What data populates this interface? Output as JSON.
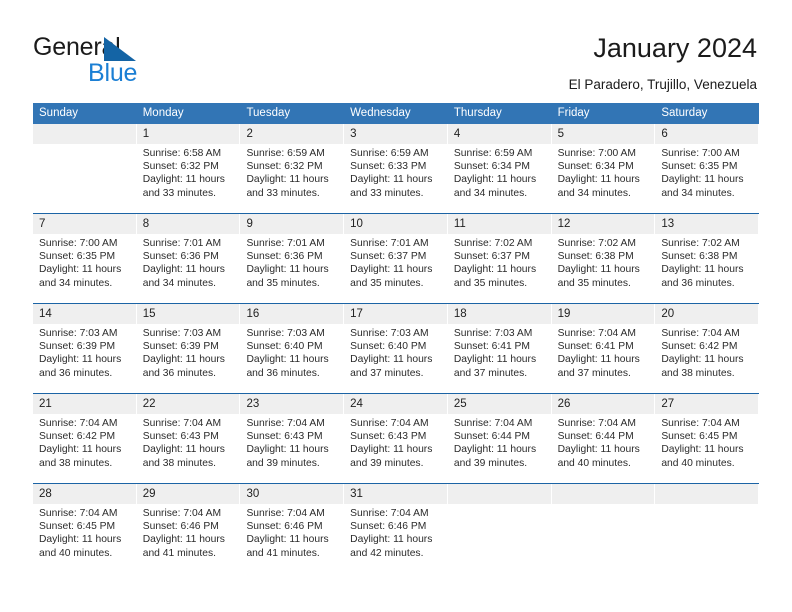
{
  "logo": {
    "word_top": "General",
    "word_bottom": "Blue",
    "triangle_color": "#1464a5",
    "blue_color": "#1b7fd4"
  },
  "header": {
    "title": "January 2024",
    "subtitle": "El Paradero, Trujillo, Venezuela"
  },
  "theme": {
    "header_blue": "#3275b5",
    "separator_blue": "#1c64a5",
    "num_band_gray": "#efefef"
  },
  "calendar": {
    "day_names": [
      "Sunday",
      "Monday",
      "Tuesday",
      "Wednesday",
      "Thursday",
      "Friday",
      "Saturday"
    ],
    "weeks": [
      [
        {
          "day": "",
          "sunrise": "",
          "sunset": "",
          "daylight_line1": "",
          "daylight_line2": ""
        },
        {
          "day": "1",
          "sunrise": "Sunrise: 6:58 AM",
          "sunset": "Sunset: 6:32 PM",
          "daylight_line1": "Daylight: 11 hours",
          "daylight_line2": "and 33 minutes."
        },
        {
          "day": "2",
          "sunrise": "Sunrise: 6:59 AM",
          "sunset": "Sunset: 6:32 PM",
          "daylight_line1": "Daylight: 11 hours",
          "daylight_line2": "and 33 minutes."
        },
        {
          "day": "3",
          "sunrise": "Sunrise: 6:59 AM",
          "sunset": "Sunset: 6:33 PM",
          "daylight_line1": "Daylight: 11 hours",
          "daylight_line2": "and 33 minutes."
        },
        {
          "day": "4",
          "sunrise": "Sunrise: 6:59 AM",
          "sunset": "Sunset: 6:34 PM",
          "daylight_line1": "Daylight: 11 hours",
          "daylight_line2": "and 34 minutes."
        },
        {
          "day": "5",
          "sunrise": "Sunrise: 7:00 AM",
          "sunset": "Sunset: 6:34 PM",
          "daylight_line1": "Daylight: 11 hours",
          "daylight_line2": "and 34 minutes."
        },
        {
          "day": "6",
          "sunrise": "Sunrise: 7:00 AM",
          "sunset": "Sunset: 6:35 PM",
          "daylight_line1": "Daylight: 11 hours",
          "daylight_line2": "and 34 minutes."
        }
      ],
      [
        {
          "day": "7",
          "sunrise": "Sunrise: 7:00 AM",
          "sunset": "Sunset: 6:35 PM",
          "daylight_line1": "Daylight: 11 hours",
          "daylight_line2": "and 34 minutes."
        },
        {
          "day": "8",
          "sunrise": "Sunrise: 7:01 AM",
          "sunset": "Sunset: 6:36 PM",
          "daylight_line1": "Daylight: 11 hours",
          "daylight_line2": "and 34 minutes."
        },
        {
          "day": "9",
          "sunrise": "Sunrise: 7:01 AM",
          "sunset": "Sunset: 6:36 PM",
          "daylight_line1": "Daylight: 11 hours",
          "daylight_line2": "and 35 minutes."
        },
        {
          "day": "10",
          "sunrise": "Sunrise: 7:01 AM",
          "sunset": "Sunset: 6:37 PM",
          "daylight_line1": "Daylight: 11 hours",
          "daylight_line2": "and 35 minutes."
        },
        {
          "day": "11",
          "sunrise": "Sunrise: 7:02 AM",
          "sunset": "Sunset: 6:37 PM",
          "daylight_line1": "Daylight: 11 hours",
          "daylight_line2": "and 35 minutes."
        },
        {
          "day": "12",
          "sunrise": "Sunrise: 7:02 AM",
          "sunset": "Sunset: 6:38 PM",
          "daylight_line1": "Daylight: 11 hours",
          "daylight_line2": "and 35 minutes."
        },
        {
          "day": "13",
          "sunrise": "Sunrise: 7:02 AM",
          "sunset": "Sunset: 6:38 PM",
          "daylight_line1": "Daylight: 11 hours",
          "daylight_line2": "and 36 minutes."
        }
      ],
      [
        {
          "day": "14",
          "sunrise": "Sunrise: 7:03 AM",
          "sunset": "Sunset: 6:39 PM",
          "daylight_line1": "Daylight: 11 hours",
          "daylight_line2": "and 36 minutes."
        },
        {
          "day": "15",
          "sunrise": "Sunrise: 7:03 AM",
          "sunset": "Sunset: 6:39 PM",
          "daylight_line1": "Daylight: 11 hours",
          "daylight_line2": "and 36 minutes."
        },
        {
          "day": "16",
          "sunrise": "Sunrise: 7:03 AM",
          "sunset": "Sunset: 6:40 PM",
          "daylight_line1": "Daylight: 11 hours",
          "daylight_line2": "and 36 minutes."
        },
        {
          "day": "17",
          "sunrise": "Sunrise: 7:03 AM",
          "sunset": "Sunset: 6:40 PM",
          "daylight_line1": "Daylight: 11 hours",
          "daylight_line2": "and 37 minutes."
        },
        {
          "day": "18",
          "sunrise": "Sunrise: 7:03 AM",
          "sunset": "Sunset: 6:41 PM",
          "daylight_line1": "Daylight: 11 hours",
          "daylight_line2": "and 37 minutes."
        },
        {
          "day": "19",
          "sunrise": "Sunrise: 7:04 AM",
          "sunset": "Sunset: 6:41 PM",
          "daylight_line1": "Daylight: 11 hours",
          "daylight_line2": "and 37 minutes."
        },
        {
          "day": "20",
          "sunrise": "Sunrise: 7:04 AM",
          "sunset": "Sunset: 6:42 PM",
          "daylight_line1": "Daylight: 11 hours",
          "daylight_line2": "and 38 minutes."
        }
      ],
      [
        {
          "day": "21",
          "sunrise": "Sunrise: 7:04 AM",
          "sunset": "Sunset: 6:42 PM",
          "daylight_line1": "Daylight: 11 hours",
          "daylight_line2": "and 38 minutes."
        },
        {
          "day": "22",
          "sunrise": "Sunrise: 7:04 AM",
          "sunset": "Sunset: 6:43 PM",
          "daylight_line1": "Daylight: 11 hours",
          "daylight_line2": "and 38 minutes."
        },
        {
          "day": "23",
          "sunrise": "Sunrise: 7:04 AM",
          "sunset": "Sunset: 6:43 PM",
          "daylight_line1": "Daylight: 11 hours",
          "daylight_line2": "and 39 minutes."
        },
        {
          "day": "24",
          "sunrise": "Sunrise: 7:04 AM",
          "sunset": "Sunset: 6:43 PM",
          "daylight_line1": "Daylight: 11 hours",
          "daylight_line2": "and 39 minutes."
        },
        {
          "day": "25",
          "sunrise": "Sunrise: 7:04 AM",
          "sunset": "Sunset: 6:44 PM",
          "daylight_line1": "Daylight: 11 hours",
          "daylight_line2": "and 39 minutes."
        },
        {
          "day": "26",
          "sunrise": "Sunrise: 7:04 AM",
          "sunset": "Sunset: 6:44 PM",
          "daylight_line1": "Daylight: 11 hours",
          "daylight_line2": "and 40 minutes."
        },
        {
          "day": "27",
          "sunrise": "Sunrise: 7:04 AM",
          "sunset": "Sunset: 6:45 PM",
          "daylight_line1": "Daylight: 11 hours",
          "daylight_line2": "and 40 minutes."
        }
      ],
      [
        {
          "day": "28",
          "sunrise": "Sunrise: 7:04 AM",
          "sunset": "Sunset: 6:45 PM",
          "daylight_line1": "Daylight: 11 hours",
          "daylight_line2": "and 40 minutes."
        },
        {
          "day": "29",
          "sunrise": "Sunrise: 7:04 AM",
          "sunset": "Sunset: 6:46 PM",
          "daylight_line1": "Daylight: 11 hours",
          "daylight_line2": "and 41 minutes."
        },
        {
          "day": "30",
          "sunrise": "Sunrise: 7:04 AM",
          "sunset": "Sunset: 6:46 PM",
          "daylight_line1": "Daylight: 11 hours",
          "daylight_line2": "and 41 minutes."
        },
        {
          "day": "31",
          "sunrise": "Sunrise: 7:04 AM",
          "sunset": "Sunset: 6:46 PM",
          "daylight_line1": "Daylight: 11 hours",
          "daylight_line2": "and 42 minutes."
        },
        {
          "day": "",
          "sunrise": "",
          "sunset": "",
          "daylight_line1": "",
          "daylight_line2": ""
        },
        {
          "day": "",
          "sunrise": "",
          "sunset": "",
          "daylight_line1": "",
          "daylight_line2": ""
        },
        {
          "day": "",
          "sunrise": "",
          "sunset": "",
          "daylight_line1": "",
          "daylight_line2": ""
        }
      ]
    ]
  }
}
